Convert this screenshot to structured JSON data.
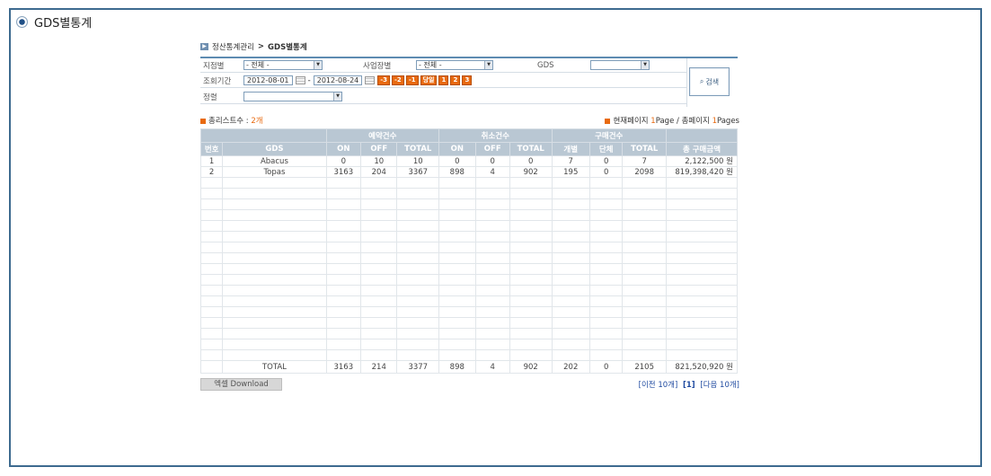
{
  "page": {
    "title": "GDS별통계"
  },
  "breadcrumb": {
    "parent": "정산통계관리",
    "separator": ">",
    "current": "GDS별통계"
  },
  "search": {
    "branch_label": "지점별",
    "branch_value": "- 전체 -",
    "site_label": "사업장별",
    "site_value": "- 전체 -",
    "gds_label": "GDS",
    "gds_value": "",
    "period_label": "조회기간",
    "date_from": "2012-08-01",
    "date_sep": "-",
    "date_to": "2012-08-24",
    "quick": [
      "-3",
      "-2",
      "-1",
      "당일",
      "1",
      "2",
      "3"
    ],
    "sort_label": "정렬",
    "sort_value": "",
    "search_button": "검색"
  },
  "summary": {
    "total_label": "총리스트수 : ",
    "total_count": "2개",
    "current_label": "현재페이지 ",
    "current_page": "1",
    "page_word": "Page",
    "sep": " / ",
    "total_pages_label": "총페이지 ",
    "total_pages": "1",
    "pages_word": "Pages"
  },
  "table": {
    "group_headers": [
      "예약건수",
      "취소건수",
      "구매건수"
    ],
    "columns": [
      "번호",
      "GDS",
      "ON",
      "OFF",
      "TOTAL",
      "ON",
      "OFF",
      "TOTAL",
      "개별",
      "단체",
      "TOTAL",
      "총 구매금액"
    ],
    "rows": [
      [
        "1",
        "Abacus",
        "0",
        "10",
        "10",
        "0",
        "0",
        "0",
        "7",
        "0",
        "7",
        "2,122,500 원"
      ],
      [
        "2",
        "Topas",
        "3163",
        "204",
        "3367",
        "898",
        "4",
        "902",
        "195",
        "0",
        "2098",
        "819,398,420 원"
      ]
    ],
    "total_row": [
      "",
      "TOTAL",
      "3163",
      "214",
      "3377",
      "898",
      "4",
      "902",
      "202",
      "0",
      "2105",
      "821,520,920 원"
    ]
  },
  "footer": {
    "excel_button": "엑셀 Download",
    "prev": "[이전 10개]",
    "current_page": "[1]",
    "next": "[다음 10개]"
  },
  "colors": {
    "frame": "#3d6a8f",
    "header": "#b9c7d3",
    "accent": "#e86a10",
    "link": "#1f4aa0"
  }
}
